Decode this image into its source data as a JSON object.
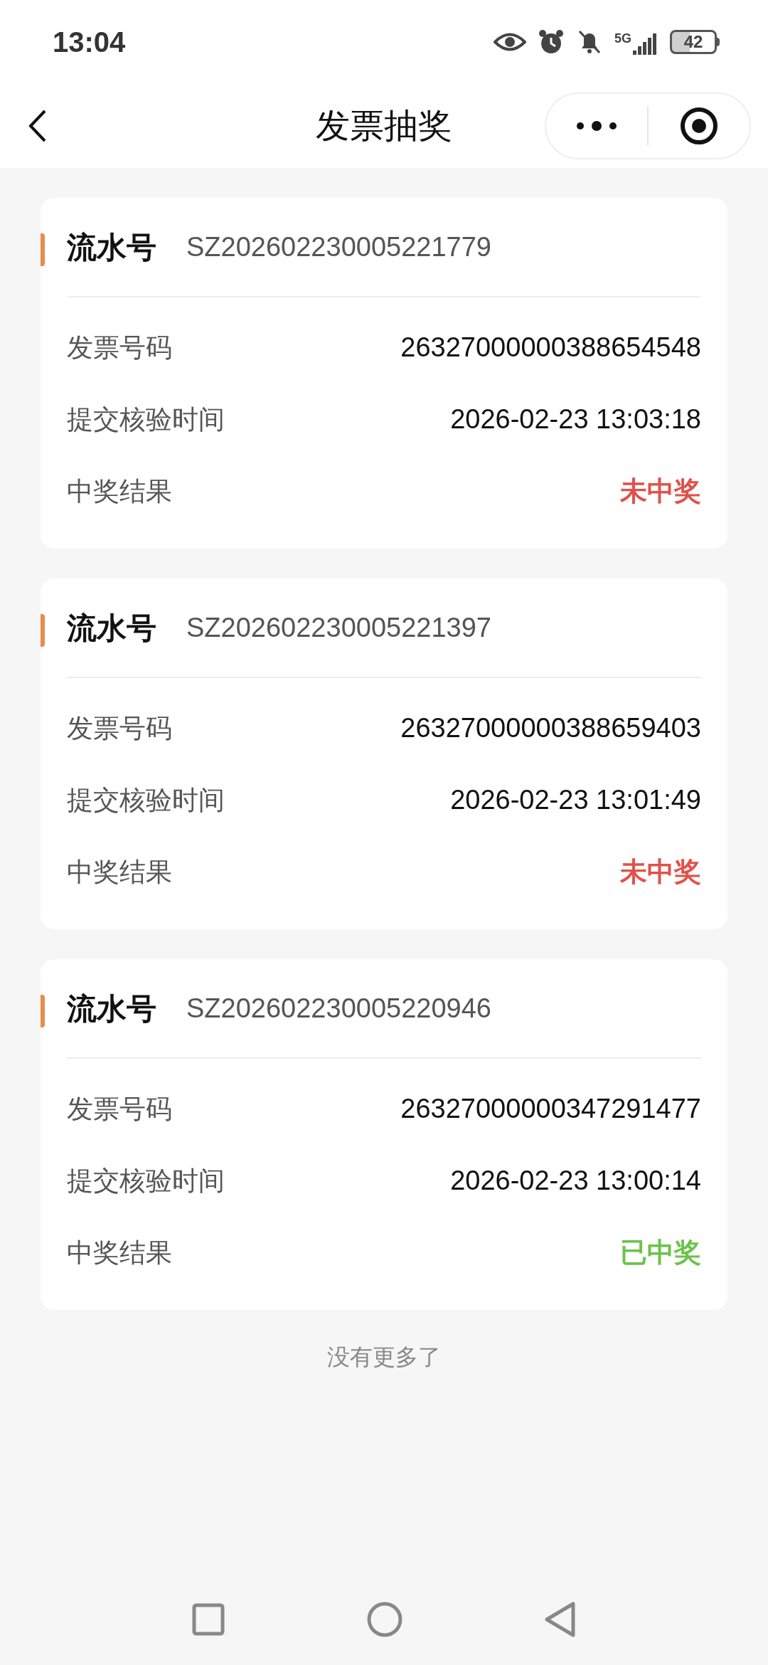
{
  "status_bar": {
    "time": "13:04",
    "network": "5G",
    "battery": "42"
  },
  "nav": {
    "title": "发票抽奖"
  },
  "records": [
    {
      "serial_label": "流水号",
      "serial": "SZ202602230005221779",
      "fields": [
        {
          "label": "发票号码",
          "value": "26327000000388654548"
        },
        {
          "label": "提交核验时间",
          "value": "2026-02-23 13:03:18"
        },
        {
          "label": "中奖结果",
          "value": "未中奖",
          "kind": "result",
          "won": false
        }
      ]
    },
    {
      "serial_label": "流水号",
      "serial": "SZ202602230005221397",
      "fields": [
        {
          "label": "发票号码",
          "value": "26327000000388659403"
        },
        {
          "label": "提交核验时间",
          "value": "2026-02-23 13:01:49"
        },
        {
          "label": "中奖结果",
          "value": "未中奖",
          "kind": "result",
          "won": false
        }
      ]
    },
    {
      "serial_label": "流水号",
      "serial": "SZ202602230005220946",
      "fields": [
        {
          "label": "发票号码",
          "value": "26327000000347291477"
        },
        {
          "label": "提交核验时间",
          "value": "2026-02-23 13:00:14"
        },
        {
          "label": "中奖结果",
          "value": "已中奖",
          "kind": "result",
          "won": true
        }
      ]
    }
  ],
  "footer_note": "没有更多了"
}
